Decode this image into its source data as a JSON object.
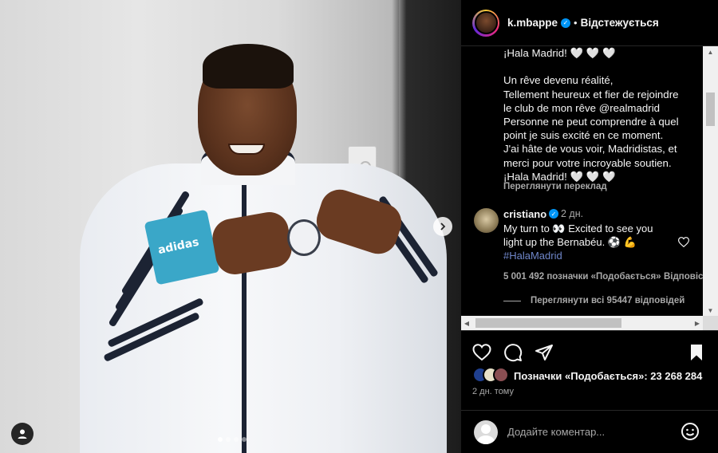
{
  "post": {
    "carousel": {
      "total": 4,
      "active": 1
    }
  },
  "header": {
    "username": "k.mbappe",
    "separator": "•",
    "follow_state": "Відстежується"
  },
  "caption": {
    "lines": [
      "¡Hala Madrid! 🤍 🤍 🤍",
      "",
      "Un rêve devenu réalité,",
      "Tellement heureux et fier de rejoindre",
      "le club de mon rêve @realmadrid",
      "Personne ne peut comprendre à quel",
      "point je suis excité en ce moment.",
      "J'ai hâte de vous voir, Madridistas, et",
      "merci pour votre incroyable soutien.",
      "¡Hala Madrid! 🤍 🤍 🤍"
    ],
    "translate_label": "Переглянути переклад"
  },
  "comment": {
    "username": "cristiano",
    "time": "2 дн.",
    "text_line1": "My turn to 👀 Excited to see you",
    "text_line2": "light up the Bernabéu. ⚽ 💪",
    "hashtag": "#HalaMadrid",
    "likes": "5 001 492 позначки «Подобається»",
    "reply_label": "Відповісти",
    "view_replies": "Переглянути всі 95447 відповідей"
  },
  "actions": {
    "likes_text": "Позначки «Подобається»: 23 268 284",
    "post_time": "2 дн. тому"
  },
  "comment_box": {
    "placeholder": "Додайте коментар..."
  }
}
